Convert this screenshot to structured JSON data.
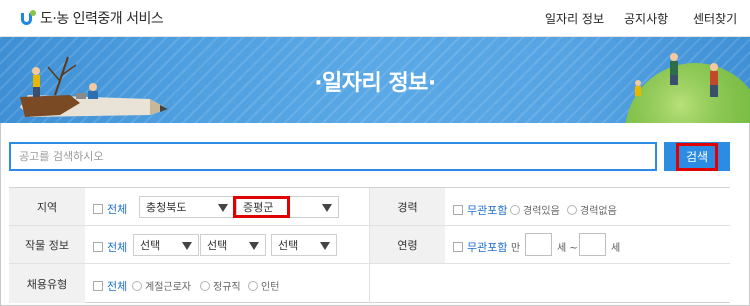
{
  "header": {
    "logo_text": "도·농 인력중개 서비스",
    "nav": [
      "일자리 정보",
      "공지사항",
      "센터찾기"
    ]
  },
  "banner": {
    "title": "·일자리 정보·"
  },
  "search": {
    "placeholder": "공고를 검색하시오",
    "button_label": "검색"
  },
  "filters": {
    "region": {
      "label": "지역",
      "all_label": "전체",
      "province": "충청북도",
      "district": "증평군"
    },
    "crop": {
      "label": "작물 정보",
      "all_label": "전체",
      "selects": [
        "선택",
        "선택",
        "선택"
      ]
    },
    "employment": {
      "label": "채용유형",
      "all_label": "전체",
      "options": [
        "계절근로자",
        "정규직",
        "인턴"
      ]
    },
    "experience": {
      "label": "경력",
      "any_label": "무관포함",
      "options": [
        "경력있음",
        "경력없음"
      ]
    },
    "age": {
      "label": "연령",
      "any_label": "무관포함",
      "prefix": "만",
      "mid": "세 ~",
      "suffix": "세"
    }
  },
  "colors": {
    "accent": "#2c8be3",
    "highlight": "#e00000",
    "link": "#1f6fd0"
  }
}
